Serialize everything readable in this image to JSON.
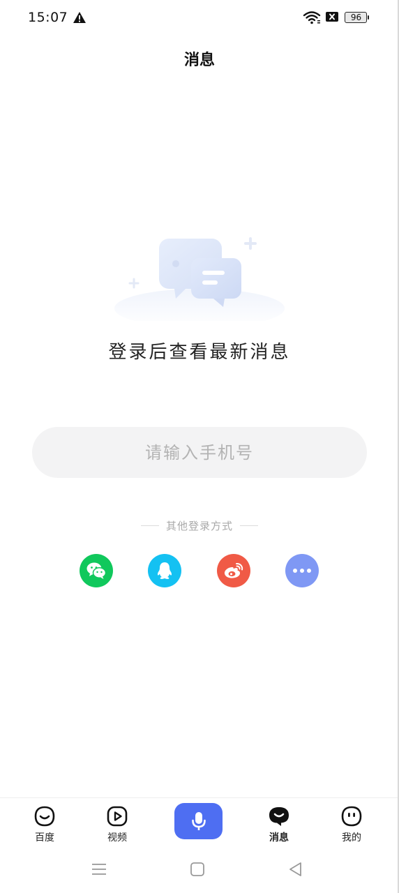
{
  "status_bar": {
    "time": "15:07",
    "battery_level": "96",
    "icons": [
      "warning-icon",
      "wifi-icon",
      "sim-blocked-icon",
      "battery-icon"
    ]
  },
  "header": {
    "title": "消息"
  },
  "empty_state": {
    "illustration": "chat-bubbles-icon",
    "message": "登录后查看最新消息"
  },
  "login": {
    "phone_placeholder": "请输入手机号",
    "phone_value": "",
    "other_methods_label": "其他登录方式",
    "methods": [
      {
        "name": "wechat",
        "icon": "wechat-icon",
        "color": "#10c85c"
      },
      {
        "name": "qq",
        "icon": "qq-icon",
        "color": "#14c1f2"
      },
      {
        "name": "weibo",
        "icon": "weibo-icon",
        "color": "#f05a46"
      },
      {
        "name": "more",
        "icon": "more-icon",
        "color": "#7f98f4"
      }
    ]
  },
  "bottom_nav": {
    "items": [
      {
        "label": "百度",
        "icon": "baidu-face-icon",
        "active": false
      },
      {
        "label": "视频",
        "icon": "video-play-icon",
        "active": false
      },
      {
        "label": "消息",
        "icon": "message-bubble-icon",
        "active": true
      },
      {
        "label": "我的",
        "icon": "profile-face-icon",
        "active": false
      }
    ],
    "voice": {
      "icon": "microphone-icon",
      "color": "#4e6ef2"
    }
  },
  "system_nav": {
    "icons": [
      "menu-icon",
      "home-icon",
      "back-icon"
    ]
  },
  "colors": {
    "accent": "#4e6ef2",
    "input_bg": "#f3f3f4",
    "muted_text": "#a8a8a8"
  }
}
